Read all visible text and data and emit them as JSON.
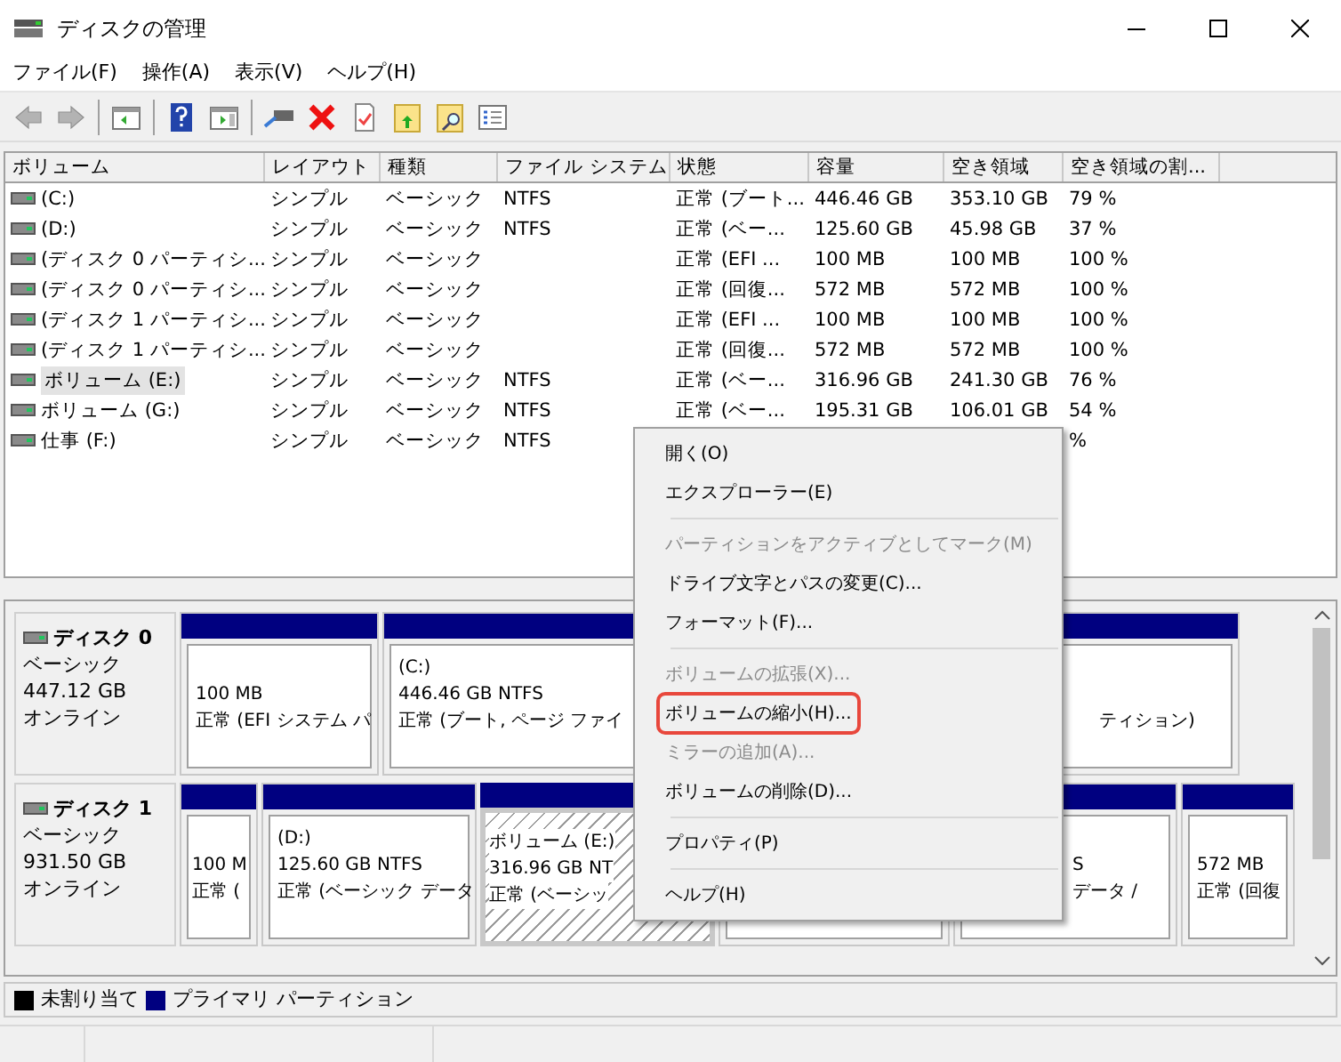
{
  "window": {
    "title": "ディスクの管理"
  },
  "menu": [
    "ファイル(F)",
    "操作(A)",
    "表示(V)",
    "ヘルプ(H)"
  ],
  "toolbar": [
    {
      "kind": "back",
      "disabled": true
    },
    {
      "kind": "forward",
      "disabled": true
    },
    {
      "kind": "sep"
    },
    {
      "kind": "tree"
    },
    {
      "kind": "sep"
    },
    {
      "kind": "help"
    },
    {
      "kind": "pane"
    },
    {
      "kind": "sep"
    },
    {
      "kind": "connect"
    },
    {
      "kind": "delete"
    },
    {
      "kind": "check"
    },
    {
      "kind": "folderup"
    },
    {
      "kind": "search"
    },
    {
      "kind": "props"
    }
  ],
  "table": {
    "columns": [
      "ボリューム",
      "レイアウト",
      "種類",
      "ファイル システム",
      "状態",
      "容量",
      "空き領域",
      "空き領域の割..."
    ],
    "rows": [
      {
        "cells": [
          "(C:)",
          "シンプル",
          "ベーシック",
          "NTFS",
          "正常 (ブート...",
          "446.46 GB",
          "353.10 GB",
          "79 %"
        ],
        "selected": false
      },
      {
        "cells": [
          "(D:)",
          "シンプル",
          "ベーシック",
          "NTFS",
          "正常 (ベー...",
          "125.60 GB",
          "45.98 GB",
          "37 %"
        ],
        "selected": false
      },
      {
        "cells": [
          "(ディスク 0 パーティシ...",
          "シンプル",
          "ベーシック",
          "",
          "正常 (EFI ...",
          "100 MB",
          "100 MB",
          "100 %"
        ],
        "selected": false
      },
      {
        "cells": [
          "(ディスク 0 パーティシ...",
          "シンプル",
          "ベーシック",
          "",
          "正常 (回復...",
          "572 MB",
          "572 MB",
          "100 %"
        ],
        "selected": false
      },
      {
        "cells": [
          "(ディスク 1 パーティシ...",
          "シンプル",
          "ベーシック",
          "",
          "正常 (EFI ...",
          "100 MB",
          "100 MB",
          "100 %"
        ],
        "selected": false
      },
      {
        "cells": [
          "(ディスク 1 パーティシ...",
          "シンプル",
          "ベーシック",
          "",
          "正常 (回復...",
          "572 MB",
          "572 MB",
          "100 %"
        ],
        "selected": false
      },
      {
        "cells": [
          "ボリューム (E:)",
          "シンプル",
          "ベーシック",
          "NTFS",
          "正常 (ベー...",
          "316.96 GB",
          "241.30 GB",
          "76 %"
        ],
        "selected": true
      },
      {
        "cells": [
          "ボリューム (G:)",
          "シンプル",
          "ベーシック",
          "NTFS",
          "正常 (ベー...",
          "195.31 GB",
          "106.01 GB",
          "54 %"
        ],
        "selected": false
      },
      {
        "cells": [
          "仕事 (F:)",
          "シンプル",
          "ベーシック",
          "NTFS",
          "",
          "",
          "",
          "%"
        ],
        "selected": false
      }
    ]
  },
  "disks": [
    {
      "name": "ディスク 0",
      "type": "ベーシック",
      "size": "447.12 GB",
      "status": "オンライン",
      "partitions": [
        {
          "lines": [
            "100 MB",
            "正常 (EFI システム パ"
          ],
          "selected": false
        },
        {
          "lines": [
            "(C:)",
            "446.46 GB NTFS",
            "正常 (ブート, ページ ファイ"
          ],
          "selected": false
        },
        {
          "lines": [
            "ティション)"
          ],
          "selected": false
        }
      ]
    },
    {
      "name": "ディスク 1",
      "type": "ベーシック",
      "size": "931.50 GB",
      "status": "オンライン",
      "partitions": [
        {
          "lines": [
            "100 M",
            "正常 ("
          ],
          "selected": false
        },
        {
          "lines": [
            "(D:)",
            "125.60 GB NTFS",
            "正常 (ベーシック データ"
          ],
          "selected": false
        },
        {
          "lines": [
            "ボリューム (E:)",
            "316.96 GB NT",
            "正常 (ベーシッ"
          ],
          "selected": true
        },
        {
          "selected": false
        },
        {
          "lines": [
            "S",
            "データ /"
          ],
          "selected": false
        },
        {
          "lines": [
            "572 MB",
            "正常 (回復"
          ],
          "selected": false
        }
      ]
    }
  ],
  "legend": [
    {
      "label": "未割り当て",
      "color": "#000000"
    },
    {
      "label": "プライマリ パーティション",
      "color": "#000080"
    }
  ],
  "context_menu": [
    {
      "kind": "item",
      "label": "開く(O)",
      "disabled": false,
      "highlighted": false
    },
    {
      "kind": "item",
      "label": "エクスプローラー(E)",
      "disabled": false,
      "highlighted": false
    },
    {
      "kind": "sep"
    },
    {
      "kind": "item",
      "label": "パーティションをアクティブとしてマーク(M)",
      "disabled": true,
      "highlighted": false
    },
    {
      "kind": "item",
      "label": "ドライブ文字とパスの変更(C)...",
      "disabled": false,
      "highlighted": false
    },
    {
      "kind": "item",
      "label": "フォーマット(F)...",
      "disabled": false,
      "highlighted": false
    },
    {
      "kind": "sep"
    },
    {
      "kind": "item",
      "label": "ボリュームの拡張(X)...",
      "disabled": true,
      "highlighted": false
    },
    {
      "kind": "item",
      "label": "ボリュームの縮小(H)...",
      "disabled": false,
      "highlighted": true
    },
    {
      "kind": "item",
      "label": "ミラーの追加(A)...",
      "disabled": true,
      "highlighted": false
    },
    {
      "kind": "item",
      "label": "ボリュームの削除(D)...",
      "disabled": false,
      "highlighted": false
    },
    {
      "kind": "sep"
    },
    {
      "kind": "item",
      "label": "プロパティ(P)",
      "disabled": false,
      "highlighted": false
    },
    {
      "kind": "sep"
    },
    {
      "kind": "item",
      "label": "ヘルプ(H)",
      "disabled": false,
      "highlighted": false
    }
  ]
}
